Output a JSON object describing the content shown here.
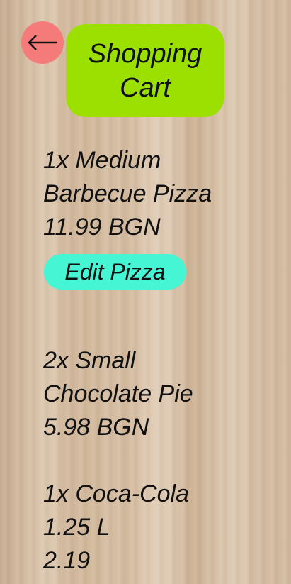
{
  "header": {
    "back_icon": "arrow-left-icon",
    "title": "Shopping Cart"
  },
  "colors": {
    "back_button": "#f47b79",
    "title_background": "#9be000",
    "edit_button": "#45f5d4"
  },
  "cart": {
    "items": [
      {
        "quantity_name": "1x Medium",
        "name_line2": "Barbecue Pizza",
        "price": "11.99 BGN",
        "edit_label": "Edit Pizza"
      },
      {
        "quantity_name": "2x Small",
        "name_line2": "Chocolate Pie",
        "price": "5.98 BGN"
      },
      {
        "quantity_name": "1x Coca-Cola",
        "name_line2": "1.25 L",
        "price": "2.19"
      }
    ]
  }
}
